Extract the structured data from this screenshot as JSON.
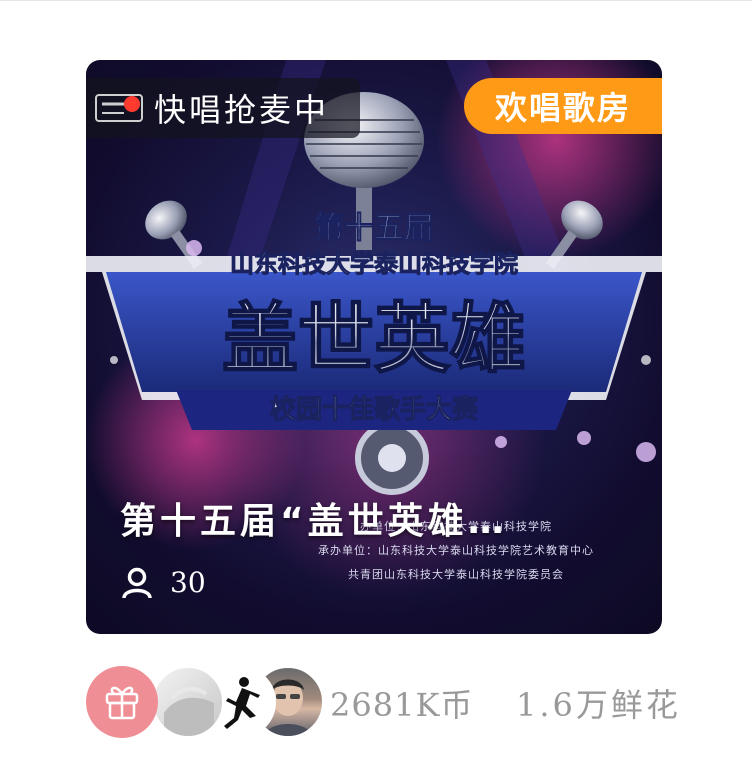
{
  "room": {
    "status_text": "快唱抢麦中",
    "category_tag": "欢唱歌房",
    "title": "第十五届“盖世英雄…",
    "listener_count": "30"
  },
  "poster": {
    "edition": "第十五届",
    "school": "山东科技大学泰山科技学院",
    "headline": "盖世英雄",
    "subtitle": "校园十佳歌手大赛",
    "organizer_line_1": "办单位：山东科技大学泰山科技学院",
    "organizer_line_2": "承办单位：山东科技大学泰山科技学院艺术教育中心",
    "organizer_line_3": "共青团山东科技大学泰山科技学院委员会"
  },
  "stats": {
    "coins": "2681K币",
    "flowers": "1.6万鲜花"
  },
  "icons": {
    "gift": "gift-icon",
    "listeners": "person-icon",
    "live": "live-dot-icon"
  },
  "colors": {
    "accent_tag": "#ff9a16",
    "gift_button": "#ef8f95",
    "live_dot": "#ff3b30",
    "stats_text": "#999999"
  }
}
